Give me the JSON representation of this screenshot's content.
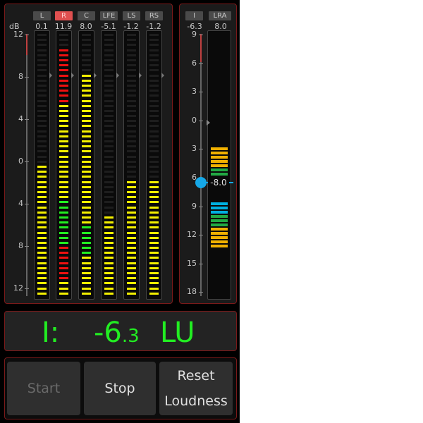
{
  "peak_meter": {
    "unit_label": "dB",
    "scale_labels": [
      "12",
      "8",
      "4",
      "0",
      "4",
      "8",
      "12"
    ],
    "channels": [
      {
        "label": "L",
        "peak": "0.1",
        "level_fraction": 0.495,
        "top_red": 0,
        "top_green": 0,
        "active": false
      },
      {
        "label": "R",
        "peak": "11.9",
        "level_fraction": 0.95,
        "top_red": 11,
        "top_green": 11,
        "active": true
      },
      {
        "label": "C",
        "peak": "8.0",
        "level_fraction": 0.84,
        "top_red": 0,
        "top_green": 9,
        "active": false
      },
      {
        "label": "LFE",
        "peak": "-5.1",
        "level_fraction": 0.3,
        "top_red": 0,
        "top_green": 0,
        "active": false
      },
      {
        "label": "LS",
        "peak": "-1.2",
        "level_fraction": 0.45,
        "top_red": 0,
        "top_green": 0,
        "active": false
      },
      {
        "label": "RS",
        "peak": "-1.2",
        "level_fraction": 0.45,
        "top_red": 0,
        "top_green": 0,
        "active": false
      }
    ]
  },
  "loudness_meter": {
    "integrated_label": "I",
    "integrated_value": "-6.3",
    "lra_label": "LRA",
    "lra_value": "8.0",
    "scale_labels": [
      "9",
      "6",
      "3",
      "0",
      "3",
      "6",
      "9",
      "12",
      "15",
      "18"
    ],
    "current_marker_label": "-8.0",
    "colors": {
      "orange": "#f0b000",
      "green": "#22aa44",
      "blue": "#00b0e0"
    }
  },
  "summary": {
    "prefix": "I:",
    "value_main": "-6",
    "value_decimal": ".3",
    "unit": "LU"
  },
  "buttons": {
    "start": "Start",
    "stop": "Stop",
    "reset_line1": "Reset",
    "reset_line2": "Loudness"
  }
}
